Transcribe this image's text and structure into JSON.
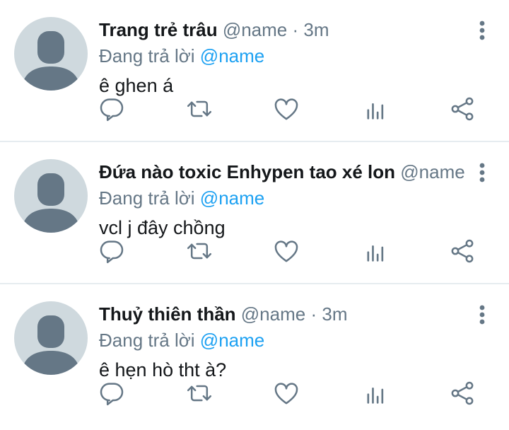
{
  "icons": {
    "reply": "reply-icon",
    "retweet": "retweet-icon",
    "like": "heart-icon",
    "analytics": "analytics-icon",
    "share": "share-icon",
    "more": "more-vertical-icon"
  },
  "colors": {
    "name": "#14171a",
    "muted": "#657786",
    "link": "#1da1f2",
    "avatar_bg": "#cfd9de",
    "avatar_fg": "#657786",
    "icon": "#657786",
    "divider": "#e6ecf0"
  },
  "tweets": [
    {
      "display_name": "Trang trẻ trâu",
      "handle": "@name",
      "separator": "·",
      "time": "3m",
      "reply_prefix": "Đang trả lời",
      "reply_to": "@name",
      "text": "ê ghen á"
    },
    {
      "display_name": "Đứa nào toxic Enhypen tao xé lon",
      "handle": "@name",
      "separator": "",
      "time": "",
      "reply_prefix": "Đang trả lời",
      "reply_to": "@name",
      "text": "vcl j đây chồng"
    },
    {
      "display_name": "Thuỷ thiên thần",
      "handle": "@name",
      "separator": "·",
      "time": "3m",
      "reply_prefix": "Đang trả lời",
      "reply_to": "@name",
      "text": "ê hẹn hò tht à?"
    }
  ]
}
